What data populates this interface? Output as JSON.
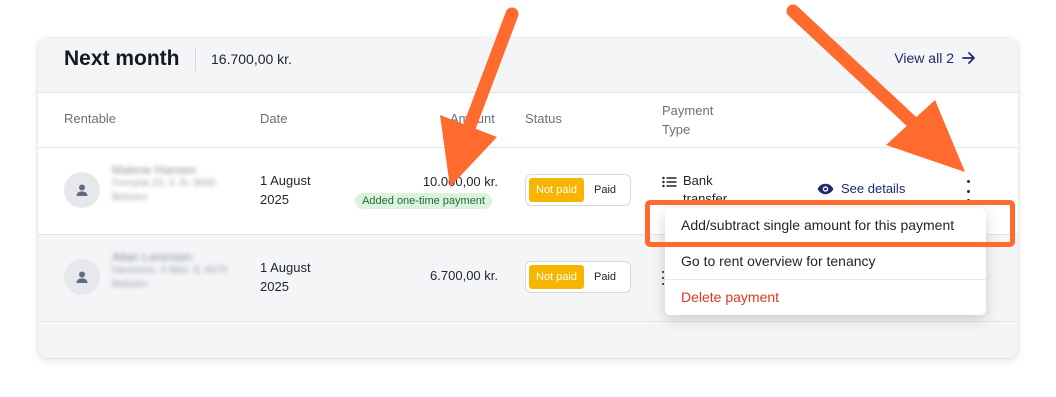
{
  "header": {
    "title": "Next month",
    "total": "16.700,00 kr.",
    "view_all": "View all 2"
  },
  "columns": {
    "rentable": "Rentable",
    "date": "Date",
    "amount": "Amount",
    "status": "Status",
    "payment_type_line1": "Payment",
    "payment_type_line2": "Type"
  },
  "rows": [
    {
      "name": "Malene Hansen",
      "address": "Ferrrpsk 23, 3. th. 8000",
      "unit": "Beboerr",
      "date_line1": "1 August",
      "date_line2": "2025",
      "amount": "10.000,00 kr.",
      "tag": "Added one-time payment",
      "status_notpaid": "Not paid",
      "status_paid": "Paid",
      "payment_type_line1": "Bank",
      "payment_type_line2": "transfer",
      "see_details": "See details"
    },
    {
      "name": "Allan Lorensen",
      "address": "Hannnesr. 3 tbbn. 8, 8470",
      "unit": "Beboerr",
      "date_line1": "1 August",
      "date_line2": "2025",
      "amount": "6.700,00 kr.",
      "status_notpaid": "Not paid",
      "status_paid": "Paid"
    }
  ],
  "menu": {
    "items": [
      "Add/subtract single amount for this payment",
      "Go to rent overview for tenancy",
      "Delete payment"
    ]
  },
  "colors": {
    "accent": "#1d2b6e",
    "not_paid": "#f7b500",
    "tag_bg": "#d9f3dd",
    "danger": "#d93a1b",
    "annotation": "#ff6a2f"
  }
}
